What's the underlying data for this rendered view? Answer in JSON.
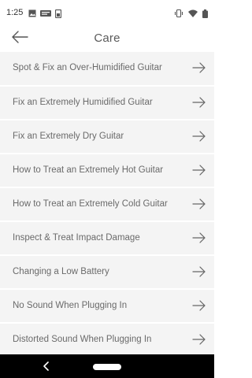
{
  "status_bar": {
    "time": "1:25",
    "left_icons": [
      "image-icon",
      "style-icon",
      "sim-icon"
    ],
    "right_icons": [
      "vibrate-icon",
      "wifi-icon",
      "battery-icon"
    ]
  },
  "header": {
    "title": "Care",
    "back_icon": "arrow-left-icon"
  },
  "list": {
    "items": [
      {
        "label": "Spot & Fix an Over-Humidified Guitar"
      },
      {
        "label": "Fix an Extremely Humidified Guitar"
      },
      {
        "label": "Fix an Extremely Dry Guitar"
      },
      {
        "label": "How to Treat an Extremely Hot Guitar"
      },
      {
        "label": "How to Treat an Extremely Cold Guitar"
      },
      {
        "label": "Inspect & Treat Impact Damage"
      },
      {
        "label": "Changing a Low Battery"
      },
      {
        "label": "No Sound When Plugging In"
      },
      {
        "label": "Distorted Sound When Plugging In"
      }
    ],
    "item_icon": "arrow-right-icon"
  },
  "nav_bar": {
    "back_icon": "nav-back-icon",
    "home_icon": "nav-home-pill"
  },
  "colors": {
    "item_bg": "#f4f4f4",
    "text": "#6a6a6a",
    "nav_bg": "#000000"
  }
}
